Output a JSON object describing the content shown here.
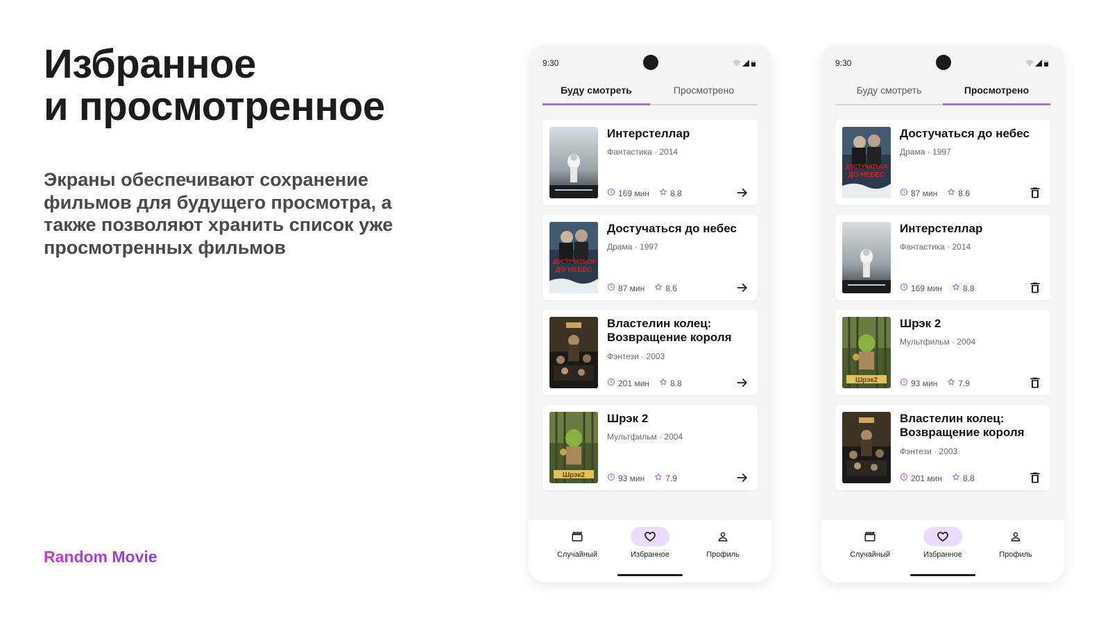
{
  "slide": {
    "title_line1": "Избранное",
    "title_line2": "и просмотренное",
    "description": "Экраны обеспечивают сохранение фильмов для будущего просмотра, а также позволяют хранить список уже просмотренных фильмов",
    "brand": "Random Movie"
  },
  "colors": {
    "accent": "#a86be0",
    "brand_gradient_start": "#c63bd8",
    "brand_gradient_end": "#8b3fe8",
    "nav_active_bg": "#eadcfa"
  },
  "phones": [
    {
      "status_time": "9:30",
      "tabs": [
        "Буду смотреть",
        "Просмотрено"
      ],
      "active_tab": 0,
      "action_icon": "arrow-right-icon",
      "movies": [
        {
          "title": "Интерстеллар",
          "meta": "Фантастика · 2014",
          "duration": "169 мин",
          "rating": "8.8",
          "poster": "interstellar"
        },
        {
          "title": "Достучаться до небес",
          "meta": "Драма · 1997",
          "duration": "87 мин",
          "rating": "8.6",
          "poster": "knockin"
        },
        {
          "title": "Властелин колец: Возвращение короля",
          "meta": "Фэнтези · 2003",
          "duration": "201 мин",
          "rating": "8.8",
          "poster": "lotr"
        },
        {
          "title": "Шрэк 2",
          "meta": "Мультфильм · 2004",
          "duration": "93 мин",
          "rating": "7.9",
          "poster": "shrek"
        }
      ],
      "nav": [
        "Случайный",
        "Избранное",
        "Профиль"
      ],
      "active_nav": 1
    },
    {
      "status_time": "9:30",
      "tabs": [
        "Буду смотреть",
        "Просмотрено"
      ],
      "active_tab": 1,
      "action_icon": "trash-icon",
      "movies": [
        {
          "title": "Достучаться до небес",
          "meta": "Драма · 1997",
          "duration": "87 мин",
          "rating": "8.6",
          "poster": "knockin"
        },
        {
          "title": "Интерстеллар",
          "meta": "Фантастика · 2014",
          "duration": "169 мин",
          "rating": "8.8",
          "poster": "interstellar"
        },
        {
          "title": "Шрэк 2",
          "meta": "Мультфильм · 2004",
          "duration": "93 мин",
          "rating": "7.9",
          "poster": "shrek"
        },
        {
          "title": "Властелин колец: Возвращение короля",
          "meta": "Фэнтези · 2003",
          "duration": "201 мин",
          "rating": "8.8",
          "poster": "lotr"
        }
      ],
      "nav": [
        "Случайный",
        "Избранное",
        "Профиль"
      ],
      "active_nav": 1
    }
  ]
}
